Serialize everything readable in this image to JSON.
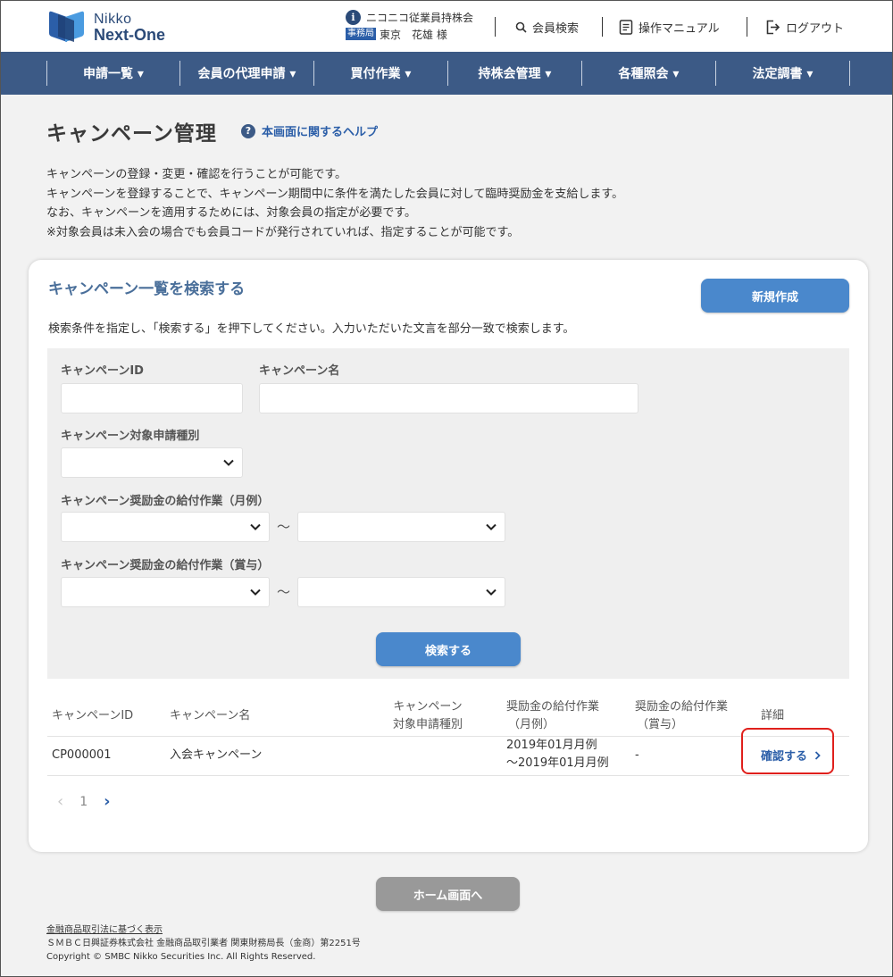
{
  "header": {
    "logo_line1": "Nikko",
    "logo_line2": "Next-One",
    "association": "ニコニコ従業員持株会",
    "role_badge": "事務局",
    "user_name": "東京　花雄 様",
    "links": {
      "member_search": "会員検索",
      "manual": "操作マニュアル",
      "logout": "ログアウト"
    }
  },
  "nav": {
    "items": [
      {
        "label": "申請一覧 ▾"
      },
      {
        "label": "会員の代理申請 ▾"
      },
      {
        "label": "買付作業 ▾"
      },
      {
        "label": "持株会管理 ▾"
      },
      {
        "label": "各種照会 ▾"
      },
      {
        "label": "法定調書 ▾"
      }
    ]
  },
  "page": {
    "title": "キャンペーン管理",
    "help_label": "本画面に関するヘルプ",
    "desc_lines": [
      "キャンペーンの登録・変更・確認を行うことが可能です。",
      "キャンペーンを登録することで、キャンペーン期間中に条件を満たした会員に対して臨時奨励金を支給します。",
      "なお、キャンペーンを適用するためには、対象会員の指定が必要です。",
      "※対象会員は未入会の場合でも会員コードが発行されていれば、指定することが可能です。"
    ]
  },
  "search": {
    "title": "キャンペーン一覧を検索する",
    "new_button": "新規作成",
    "instructions": "検索条件を指定し、「検索する」を押下してください。入力いただいた文言を部分一致で検索します。",
    "fields": {
      "campaign_id_label": "キャンペーンID",
      "campaign_id_value": "",
      "campaign_name_label": "キャンペーン名",
      "campaign_name_value": "",
      "target_type_label": "キャンペーン対象申請種別",
      "target_type_value": "",
      "monthly_label": "キャンペーン奨励金の給付作業（月例）",
      "monthly_from": "",
      "monthly_to": "",
      "bonus_label": "キャンペーン奨励金の給付作業（賞与）",
      "bonus_from": "",
      "bonus_to": "",
      "range_sep": "〜"
    },
    "search_button": "検索する"
  },
  "table": {
    "headers": {
      "id": "キャンペーンID",
      "name": "キャンペーン名",
      "type_line1": "キャンペーン",
      "type_line2": "対象申請種別",
      "monthly_line1": "奨励金の給付作業",
      "monthly_line2": "（月例）",
      "bonus_line1": "奨励金の給付作業",
      "bonus_line2": "（賞与）",
      "detail": "詳細"
    },
    "rows": [
      {
        "id": "CP000001",
        "name": "入会キャンペーン",
        "type": "",
        "monthly_line1": "2019年01月月例",
        "monthly_line2": "～2019年01月月例",
        "bonus": "-",
        "detail_link": "確認する"
      }
    ]
  },
  "pager": {
    "prev": "‹",
    "current_page": "1",
    "next": "›"
  },
  "home_button": "ホーム画面へ",
  "footer": {
    "line1": "金融商品取引法に基づく表示",
    "line2": "ＳＭＢＣ日興証券株式会社 金融商品取引業者 関東財務局長（金商）第2251号",
    "line3": "Copyright © SMBC Nikko Securities Inc. All Rights Reserved."
  },
  "colors": {
    "nav_bg": "#3c5a86",
    "primary_button": "#4a88cc",
    "title_blue": "#4a6f9a",
    "highlight_red": "#e0201c",
    "home_button": "#999999"
  }
}
